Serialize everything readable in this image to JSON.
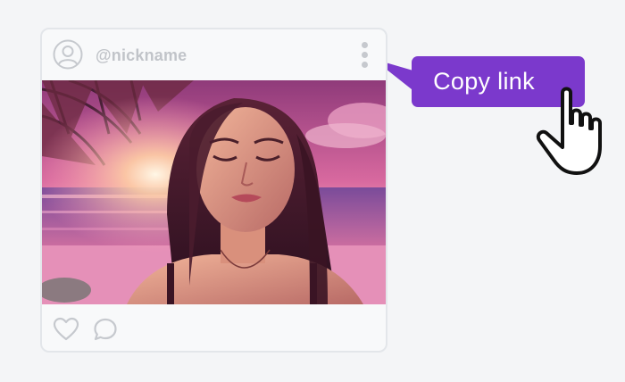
{
  "post": {
    "nickname": "@nickname",
    "avatar_icon": "user-circle-icon",
    "more_icon": "more-vertical-icon",
    "like_icon": "heart-outline-icon",
    "comment_icon": "comment-bubble-icon"
  },
  "menu": {
    "copy_link_label": "Copy link"
  },
  "cursor_icon": "hand-pointer-icon",
  "colors": {
    "accent": "#7b39cc",
    "card_border": "#e3e6ea",
    "icon_gray": "#c6c9ce",
    "background": "#f4f5f7"
  }
}
